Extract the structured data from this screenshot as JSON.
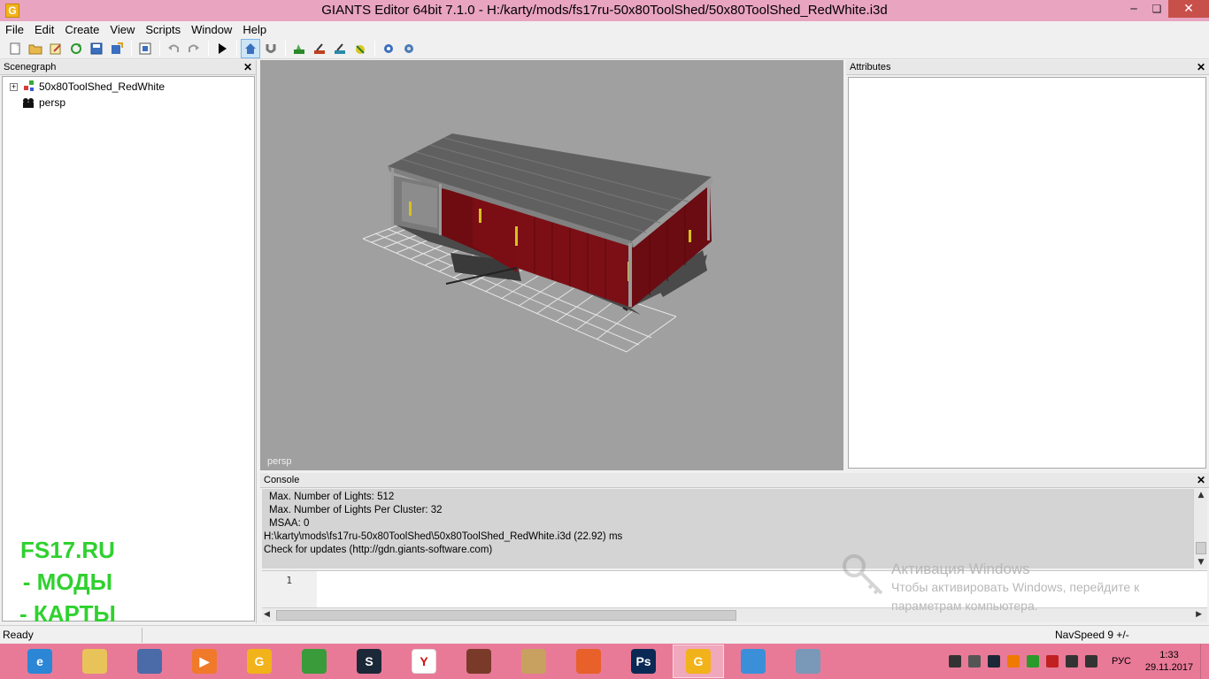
{
  "window": {
    "title": "GIANTS Editor 64bit 7.1.0 - H:/karty/mods/fs17ru-50x80ToolShed/50x80ToolShed_RedWhite.i3d",
    "app_icon_letter": "G"
  },
  "menu": [
    "File",
    "Edit",
    "Create",
    "View",
    "Scripts",
    "Window",
    "Help"
  ],
  "toolbar": {
    "buttons": [
      "new-icon",
      "open-icon",
      "edit-icon",
      "refresh-icon",
      "save-icon",
      "export-icon",
      "import-icon",
      "undo-icon",
      "redo-icon",
      "play-icon",
      "home-icon",
      "magnet-icon",
      "terrain-paint-icon",
      "terrain-sculpt-icon",
      "foliage-paint-icon",
      "foliage-edit-icon",
      "settings-gear-icon",
      "script-gear-icon"
    ]
  },
  "scenegraph": {
    "title": "Scenegraph",
    "nodes": [
      {
        "label": "50x80ToolShed_RedWhite",
        "expander": "+"
      },
      {
        "label": "persp",
        "expander": ""
      }
    ]
  },
  "viewport": {
    "camera_label": "persp"
  },
  "attributes": {
    "title": "Attributes"
  },
  "console": {
    "title": "Console",
    "lines": [
      {
        "text": "Max. Number of Lights: 512",
        "indent": true
      },
      {
        "text": "Max. Number of Lights Per Cluster: 32",
        "indent": true
      },
      {
        "text": "MSAA: 0",
        "indent": true
      },
      {
        "text": "H:\\karty\\mods\\fs17ru-50x80ToolShed\\50x80ToolShed_RedWhite.i3d (22.92) ms",
        "indent": false
      },
      {
        "text": "Check for updates (http://gdn.giants-software.com)",
        "indent": false
      }
    ],
    "input_line_number": "1"
  },
  "watermark": {
    "title": "Активация Windows",
    "line1": "Чтобы активировать Windows, перейдите к",
    "line2": "параметрам компьютера."
  },
  "promo": [
    "FS17.RU",
    "- МОДЫ",
    "- КАРТЫ"
  ],
  "status": {
    "left": "Ready",
    "right": "NavSpeed 9 +/-"
  },
  "taskbar": {
    "apps": [
      {
        "name": "internet-explorer-icon",
        "color": "#2b86d6",
        "glyph": "e"
      },
      {
        "name": "file-explorer-icon",
        "color": "#e8c35a",
        "glyph": ""
      },
      {
        "name": "paint-tool-icon",
        "color": "#4a6aa8",
        "glyph": ""
      },
      {
        "name": "media-player-icon",
        "color": "#f07a2a",
        "glyph": "▶"
      },
      {
        "name": "giants-editor-icon",
        "color": "#f2b21a",
        "glyph": "G"
      },
      {
        "name": "rubiks-cube-icon",
        "color": "#3a9b3a",
        "glyph": ""
      },
      {
        "name": "steam-icon",
        "color": "#1b2838",
        "glyph": "S"
      },
      {
        "name": "yandex-browser-icon",
        "color": "#ffffff",
        "glyph": "Y"
      },
      {
        "name": "farming-simulator-icon",
        "color": "#7a3a2a",
        "glyph": ""
      },
      {
        "name": "paint-palette-icon",
        "color": "#c8a060",
        "glyph": ""
      },
      {
        "name": "firefox-icon",
        "color": "#e8602a",
        "glyph": ""
      },
      {
        "name": "photoshop-icon",
        "color": "#0a2a55",
        "glyph": "Ps"
      },
      {
        "name": "giants-editor-active-icon",
        "color": "#f2b21a",
        "glyph": "G"
      },
      {
        "name": "cloud-weather-icon",
        "color": "#3a8fd8",
        "glyph": ""
      },
      {
        "name": "resource-monitor-icon",
        "color": "#7a98b8",
        "glyph": ""
      }
    ],
    "active_index": 12,
    "tray_icons": [
      "signal-icon",
      "battery-icon",
      "steam-tray-icon",
      "avast-icon",
      "security-check-icon",
      "flag-icon",
      "network-icon",
      "volume-icon"
    ],
    "language": "РУС",
    "time": "1:33",
    "date": "29.11.2017"
  }
}
